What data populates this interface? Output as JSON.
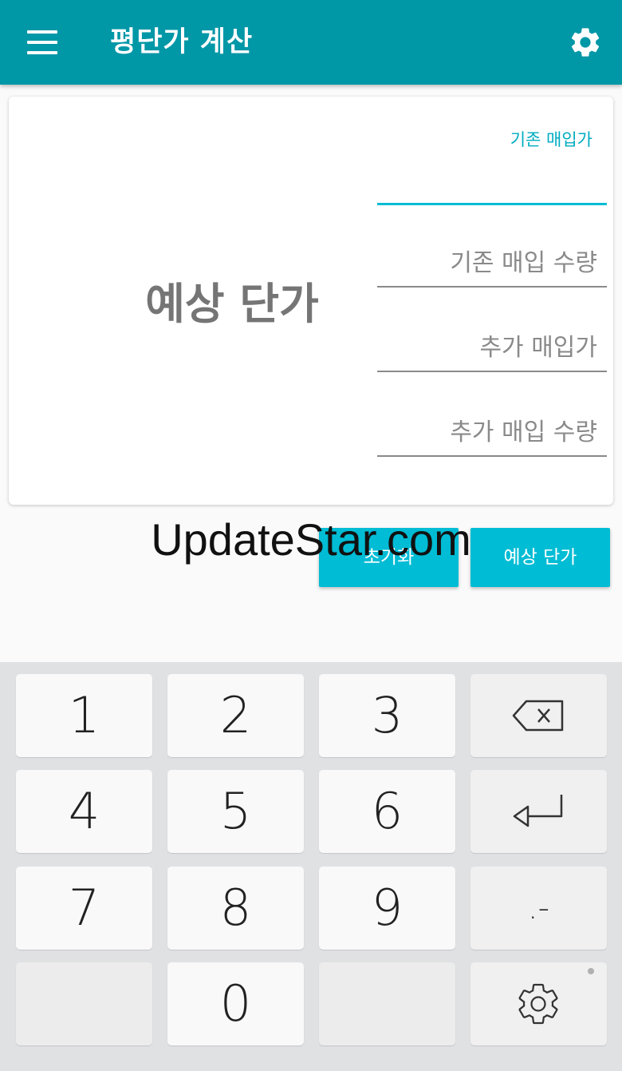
{
  "app": {
    "title": "평단가 계산"
  },
  "header_icons": {
    "menu": "hamburger-menu-icon",
    "settings": "gear-icon"
  },
  "result": {
    "label": "예상 단가"
  },
  "fields": {
    "existing_price": {
      "label": "기존 매입가",
      "value": ""
    },
    "existing_qty": {
      "placeholder": "기존 매입 수량"
    },
    "added_price": {
      "placeholder": "추가 매입가"
    },
    "added_qty": {
      "placeholder": "추가 매입 수량"
    }
  },
  "buttons": {
    "reset": "초기화",
    "calculate": "예상 단가"
  },
  "watermark": "UpdateStar.com",
  "keyboard": {
    "keys": [
      "1",
      "2",
      "3",
      "4",
      "5",
      "6",
      "7",
      "8",
      "9",
      "0"
    ],
    "punct": ".-",
    "icons": {
      "backspace": "backspace-icon",
      "enter": "enter-icon",
      "settings": "gear-icon"
    }
  },
  "colors": {
    "primary": "#0097a7",
    "accent": "#00bcd4",
    "keyboard_bg": "#e0e1e3"
  }
}
